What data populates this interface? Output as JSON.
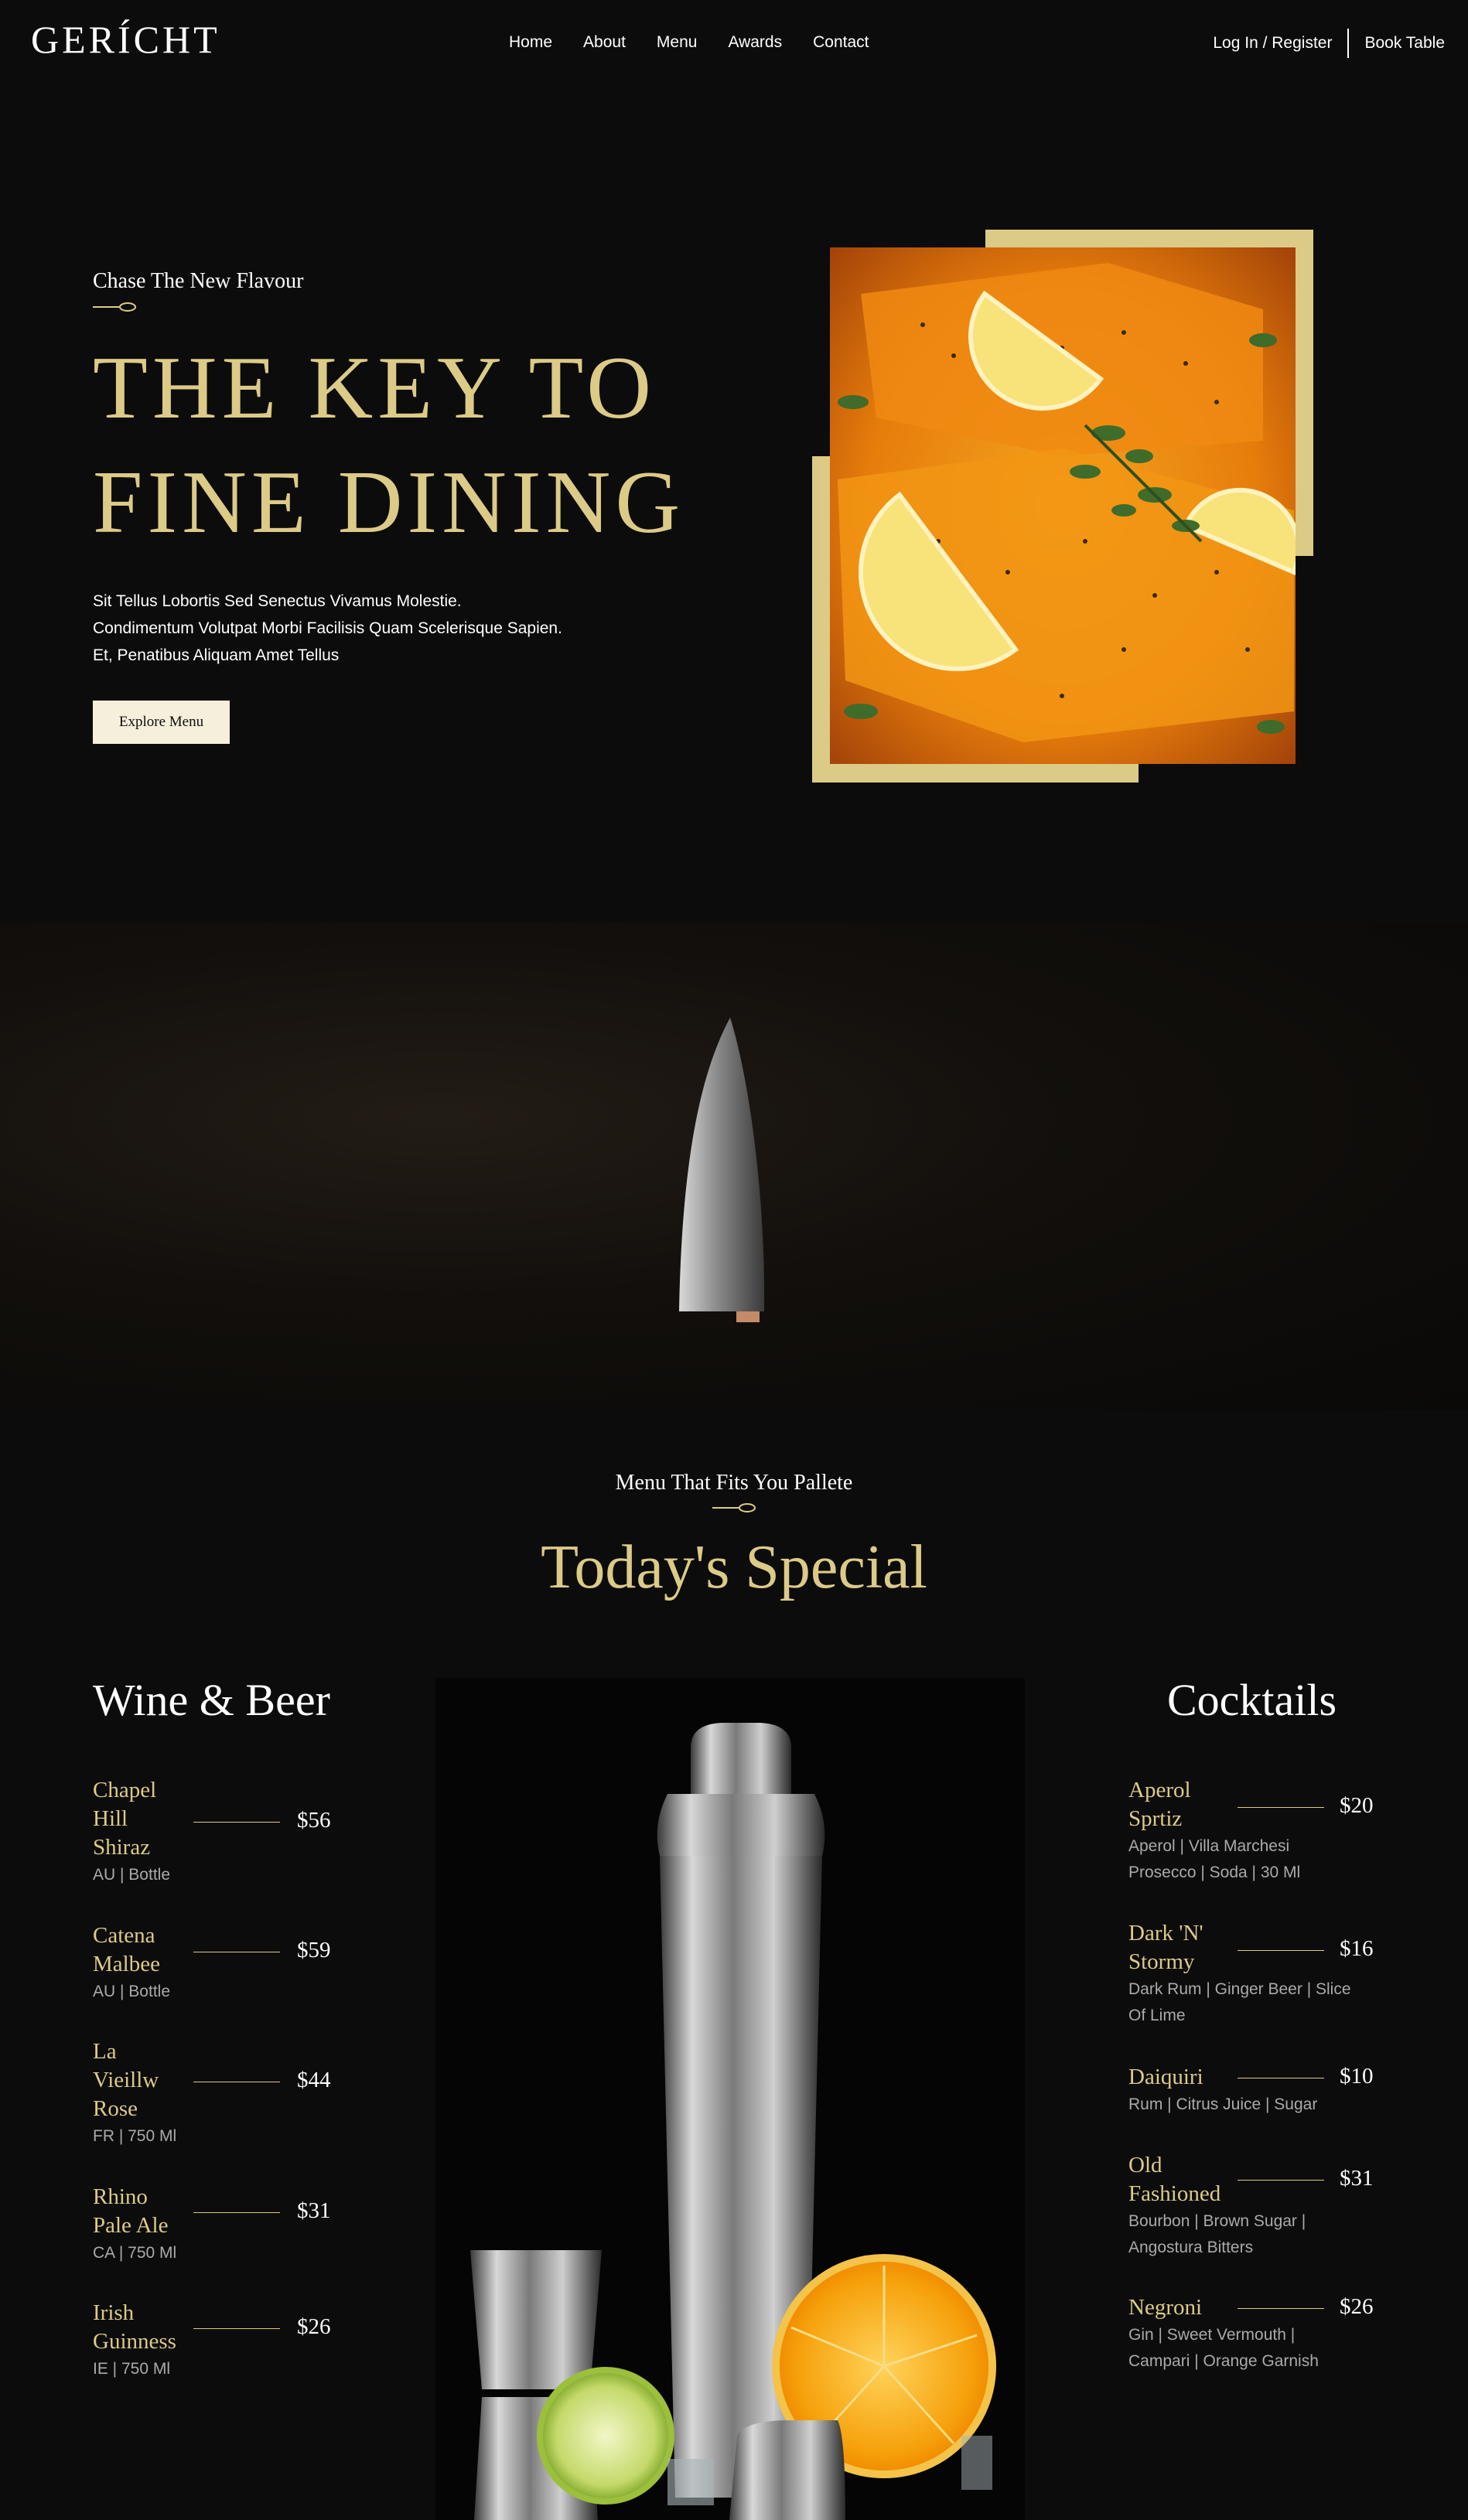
{
  "nav": {
    "logo": "GERÍCHT",
    "links": [
      "Home",
      "About",
      "Menu",
      "Awards",
      "Contact"
    ],
    "login": "Log In / Register",
    "book": "Book Table"
  },
  "hero": {
    "subtitle": "Chase The New Flavour",
    "title_line1": "THE KEY TO",
    "title_line2": "FINE DINING",
    "desc_line1": "Sit Tellus Lobortis Sed Senectus Vivamus Molestie.",
    "desc_line2": "Condimentum Volutpat Morbi Facilisis Quam Scelerisque Sapien.",
    "desc_line3": "Et, Penatibus Aliquam Amet Tellus",
    "button": "Explore Menu"
  },
  "special": {
    "subtitle": "Menu That Fits You Pallete",
    "title": "Today's Special"
  },
  "wine": {
    "title": "Wine & Beer",
    "items": [
      {
        "name_lines": [
          "Chapel",
          "Hill",
          "Shiraz"
        ],
        "price": "$56",
        "desc": "AU | Bottle"
      },
      {
        "name_lines": [
          "Catena",
          "Malbee"
        ],
        "price": "$59",
        "desc": "AU | Bottle"
      },
      {
        "name_lines": [
          "La",
          "Vieillw",
          "Rose"
        ],
        "price": "$44",
        "desc": "FR | 750 Ml"
      },
      {
        "name_lines": [
          "Rhino",
          "Pale Ale"
        ],
        "price": "$31",
        "desc": "CA | 750 Ml"
      },
      {
        "name_lines": [
          "Irish",
          "Guinness"
        ],
        "price": "$26",
        "desc": "IE | 750 Ml"
      }
    ]
  },
  "cocktails": {
    "title": "Cocktails",
    "items": [
      {
        "name_lines": [
          "Aperol",
          "Sprtiz"
        ],
        "price": "$20",
        "desc_lines": [
          "Aperol | Villa Marchesi",
          "Prosecco | Soda | 30 Ml"
        ]
      },
      {
        "name_lines": [
          "Dark 'N'",
          "Stormy"
        ],
        "price": "$16",
        "desc_lines": [
          "Dark Rum | Ginger Beer | Slice",
          "Of Lime"
        ]
      },
      {
        "name_lines": [
          "Daiquiri"
        ],
        "price": "$10",
        "desc_lines": [
          "Rum | Citrus Juice | Sugar"
        ]
      },
      {
        "name_lines": [
          "Old",
          "Fashioned"
        ],
        "price": "$31",
        "desc_lines": [
          "Bourbon | Brown Sugar |",
          "Angostura Bitters"
        ]
      },
      {
        "name_lines": [
          "Negroni"
        ],
        "price": "$26",
        "desc_lines": [
          "Gin | Sweet Vermouth |",
          "Campari | Orange Garnish"
        ]
      }
    ]
  },
  "colors": {
    "background": "#0c0c0c",
    "gold": "#dcca87",
    "crimson_button": "#f5efdb"
  }
}
